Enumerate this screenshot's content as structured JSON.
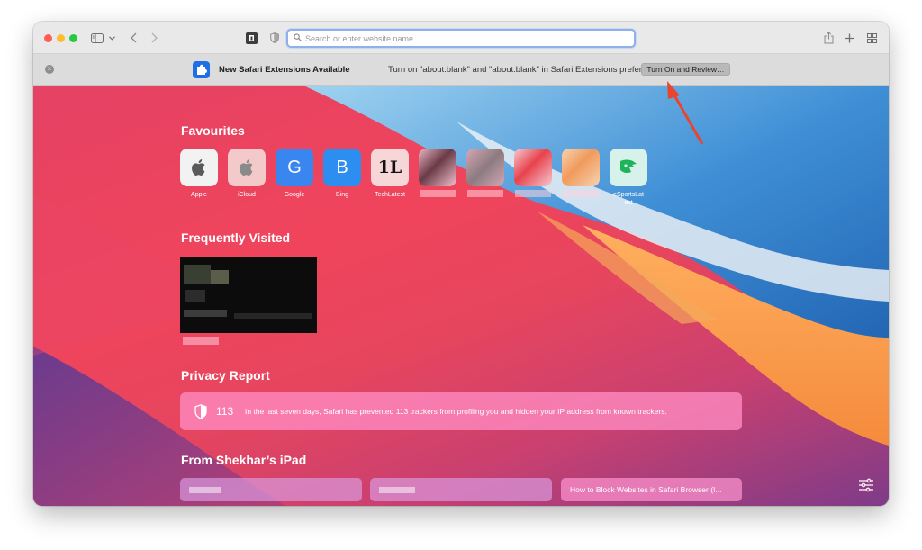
{
  "toolbar": {
    "address_placeholder": "Search or enter website name",
    "icons": [
      "sidebar-icon",
      "chevron-down-icon",
      "back-icon",
      "forward-icon",
      "extension-icon",
      "privacy-shield-icon",
      "share-icon",
      "new-tab-icon",
      "tab-overview-icon"
    ]
  },
  "notice": {
    "title": "New Safari Extensions Available",
    "message": "Turn on \"about:blank\" and \"about:blank\" in Safari Extensions preferences.",
    "button": "Turn On and Review…"
  },
  "favourites": {
    "title": "Favourites",
    "items": [
      {
        "label": "Apple",
        "glyph": ""
      },
      {
        "label": "iCloud",
        "glyph": ""
      },
      {
        "label": "Google",
        "glyph": "G"
      },
      {
        "label": "Bing",
        "glyph": "B"
      },
      {
        "label": "TechLatest",
        "glyph": "1L"
      },
      {
        "label": "eSportsLat\nest",
        "glyph": ""
      }
    ]
  },
  "frequently_visited": {
    "title": "Frequently Visited"
  },
  "privacy": {
    "title": "Privacy Report",
    "count": "113",
    "text": "In the last seven days, Safari has prevented 113 trackers from profiling you and hidden your IP address from known trackers."
  },
  "ipad": {
    "title": "From Shekhar’s iPad",
    "tab": "How to Block Websites in Safari Browser (I..."
  },
  "colors": {
    "accent": "#1e6fe6",
    "arrow": "#e8442e"
  }
}
